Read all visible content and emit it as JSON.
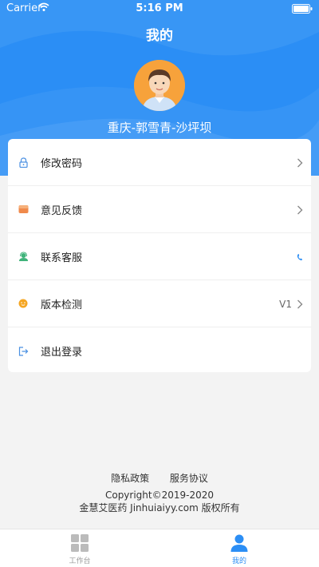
{
  "status_bar": {
    "carrier": "Carrier",
    "time": "5:16 PM"
  },
  "header": {
    "title": "我的",
    "user_name": "重庆-郭雪青-沙坪坝",
    "color": "#2b8ef5"
  },
  "menu": {
    "items": [
      {
        "label": "修改密码",
        "icon": "lock-icon",
        "right_text": ""
      },
      {
        "label": "意见反馈",
        "icon": "feedback-icon",
        "right_text": ""
      },
      {
        "label": "联系客服",
        "icon": "customer-service-icon",
        "right_text": ""
      },
      {
        "label": "版本检测",
        "icon": "version-icon",
        "right_text": "V1"
      },
      {
        "label": "退出登录",
        "icon": "logout-icon",
        "right_text": ""
      }
    ]
  },
  "footer": {
    "privacy": "隐私政策",
    "service": "服务协议",
    "copyright": "Copyright©2019-2020",
    "company": "金慧艾医药 Jinhuiaiyy.com 版权所有"
  },
  "tabs": [
    {
      "label": "工作台",
      "icon": "grid-icon",
      "active": false
    },
    {
      "label": "我的",
      "icon": "person-icon",
      "active": true
    }
  ]
}
